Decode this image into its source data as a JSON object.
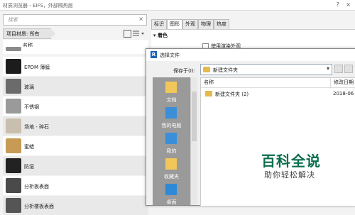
{
  "material_browser": {
    "title": "材质浏览器 - EIFS，外部隔热层",
    "controls": {
      "help": "?",
      "close": "×"
    },
    "search_placeholder": "搜索",
    "search_clear": "×",
    "filter_label": "项目材质: 所有",
    "column_name": "名称",
    "materials": [
      {
        "name": "",
        "color": "#8a8a8a"
      },
      {
        "name": "EPDM 薄膜",
        "color": "#1c1c1c"
      },
      {
        "name": "玻璃",
        "color": "#6b6b6b"
      },
      {
        "name": "不锈钢",
        "color": "#9a9a9a"
      },
      {
        "name": "场地 - 碎石",
        "color": "#c9bfae"
      },
      {
        "name": "蜜蜡",
        "color": "#c79a55"
      },
      {
        "name": "防湿",
        "color": "#222222"
      },
      {
        "name": "分析板表面",
        "color": "#4a4a4a"
      },
      {
        "name": "分析楼板表面",
        "color": "#555555"
      },
      {
        "name": "",
        "color": "#3c3c3c"
      }
    ],
    "tabs": [
      "标识",
      "图形",
      "外观",
      "物理",
      "热度"
    ],
    "active_tab": "图形",
    "section_label": "▾ 着色",
    "checkbox_label": "使用渲染外观"
  },
  "file_dialog": {
    "title": "选择文件",
    "save_in_label": "保存于(I):",
    "save_in_value": "新建文件夹",
    "places": [
      {
        "label": "文档",
        "color": "#f1c75a"
      },
      {
        "label": "我的电脑",
        "color": "#3a8fd8"
      },
      {
        "label": "我的",
        "color": "#3a8fd8"
      },
      {
        "label": "收藏夹",
        "color": "#f1c75a"
      },
      {
        "label": "桌面",
        "color": "#2e8ad6"
      }
    ],
    "col_name": "名称",
    "col_date": "修改日期",
    "files": [
      {
        "name": "新建文件夹 (2)",
        "date": "2018-06"
      }
    ]
  },
  "watermark": {
    "title": "百科全说",
    "subtitle": "助你轻松解决"
  },
  "colors": {
    "accent": "#0a6e4c",
    "folder": "#e6b94f"
  }
}
